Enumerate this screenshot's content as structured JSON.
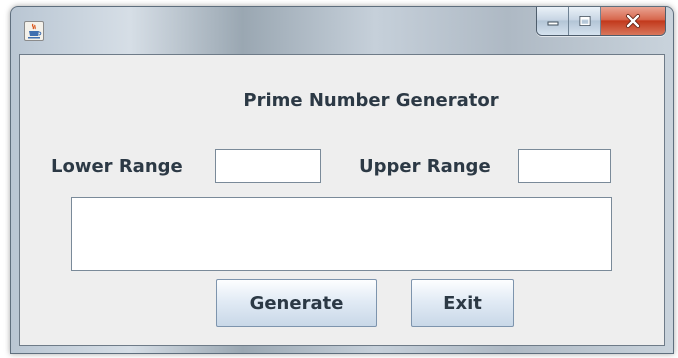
{
  "window": {
    "icon": "java-cup-icon",
    "controls": {
      "minimize_icon": "minimize-icon",
      "maximize_icon": "maximize-icon",
      "close_icon": "close-icon"
    }
  },
  "form": {
    "title": "Prime Number Generator",
    "lower_label": "Lower Range",
    "upper_label": "Upper Range",
    "lower_value": "",
    "upper_value": "",
    "output_text": "",
    "generate_label": "Generate",
    "exit_label": "Exit"
  },
  "colors": {
    "label_text": "#2c3945",
    "panel_background": "#eeeeee",
    "close_button": "#c2391c"
  }
}
